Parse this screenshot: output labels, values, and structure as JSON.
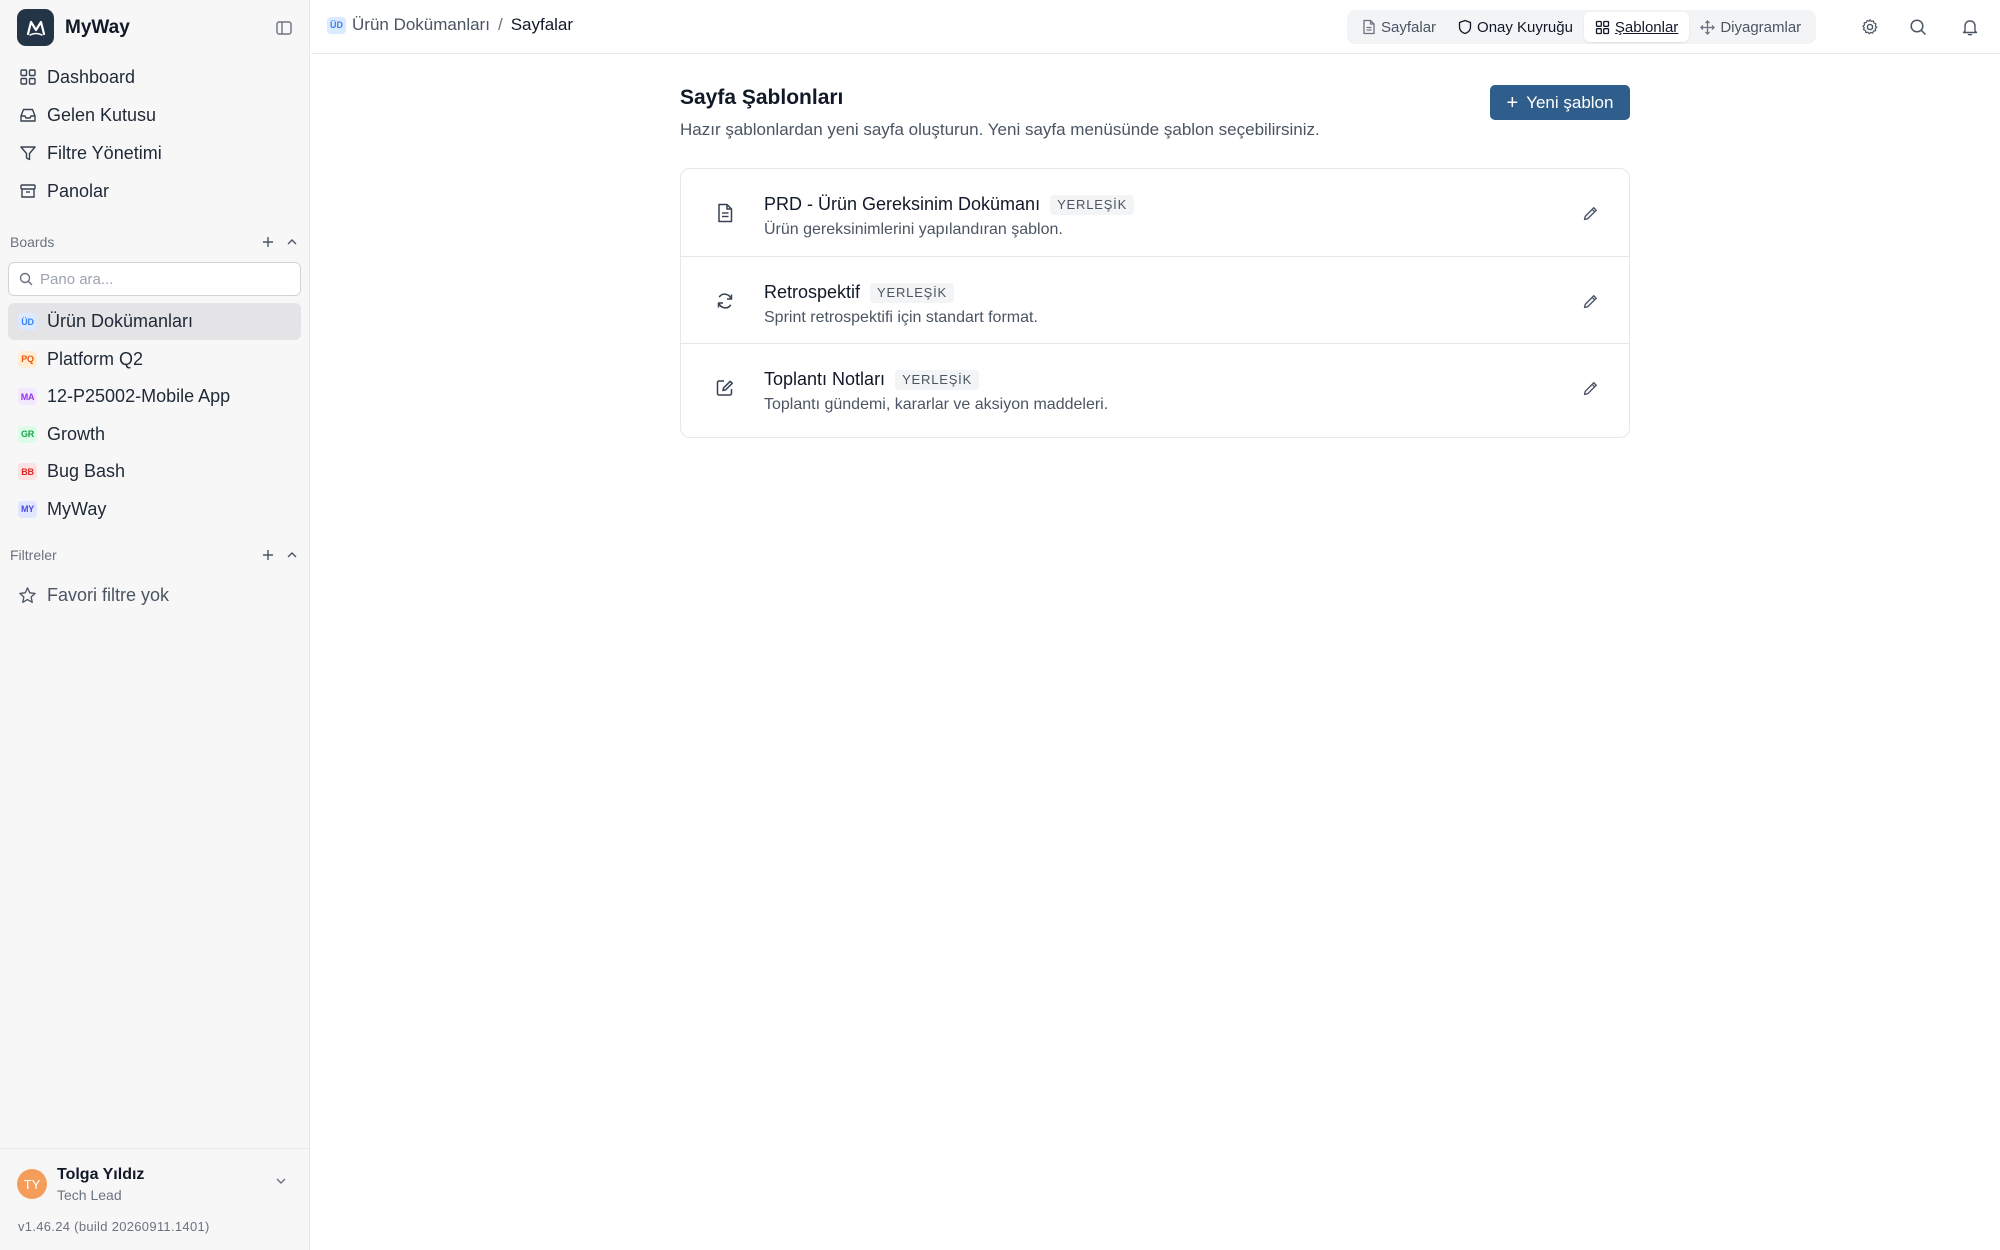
{
  "app": {
    "name": "MyWay"
  },
  "sidebar": {
    "nav": [
      {
        "label": "Dashboard",
        "icon": "dashboard-icon"
      },
      {
        "label": "Gelen Kutusu",
        "icon": "inbox-icon"
      },
      {
        "label": "Filtre Yönetimi",
        "icon": "filter-icon"
      },
      {
        "label": "Panolar",
        "icon": "archive-icon"
      }
    ],
    "boards_heading": "Boards",
    "board_search_placeholder": "Pano ara...",
    "boards": [
      {
        "abbr": "ÜD",
        "label": "Ürün Dokümanları",
        "active": true,
        "badge_bg": "#dbeafe",
        "badge_fg": "#3b82f6"
      },
      {
        "abbr": "PQ",
        "label": "Platform Q2",
        "active": false,
        "badge_bg": "#ffedd5",
        "badge_fg": "#ea580c"
      },
      {
        "abbr": "MA",
        "label": "12-P25002-Mobile App",
        "active": false,
        "badge_bg": "#f3e8ff",
        "badge_fg": "#9333ea"
      },
      {
        "abbr": "GR",
        "label": "Growth",
        "active": false,
        "badge_bg": "#dcfce7",
        "badge_fg": "#16a34a"
      },
      {
        "abbr": "BB",
        "label": "Bug Bash",
        "active": false,
        "badge_bg": "#fee2e2",
        "badge_fg": "#dc2626"
      },
      {
        "abbr": "MY",
        "label": "MyWay",
        "active": false,
        "badge_bg": "#e0e7ff",
        "badge_fg": "#4f46e5"
      }
    ],
    "filters_heading": "Filtreler",
    "favorites_empty": "Favori filtre yok",
    "user": {
      "initials": "TY",
      "name": "Tolga Yıldız",
      "role": "Tech Lead"
    },
    "version": "v1.46.24 (build 20260911.1401)"
  },
  "topbar": {
    "breadcrumb": {
      "board_abbr": "ÜD",
      "board": "Ürün Dokümanları",
      "separator": "/",
      "current": "Sayfalar"
    },
    "tabs": [
      {
        "label": "Sayfalar",
        "icon": "file-icon"
      },
      {
        "label": "Onay Kuyruğu",
        "icon": "shield-icon"
      },
      {
        "label": "Şablonlar",
        "icon": "grid-icon"
      },
      {
        "label": "Diyagramlar",
        "icon": "diagram-icon"
      }
    ]
  },
  "main": {
    "title": "Sayfa Şablonları",
    "subtitle": "Hazır şablonlardan yeni sayfa oluşturun. Yeni sayfa menüsünde şablon seçebilirsiniz.",
    "new_button": {
      "plus": "+",
      "label": "Yeni şablon"
    },
    "templates": [
      {
        "name": "PRD - Ürün Gereksinim Dokümanı",
        "badge": "YERLEŞİK",
        "desc": "Ürün gereksinimlerini yapılandıran şablon.",
        "icon": "document-icon"
      },
      {
        "name": "Retrospektif",
        "badge": "YERLEŞİK",
        "desc": "Sprint retrospektifi için standart format.",
        "icon": "refresh-icon"
      },
      {
        "name": "Toplantı Notları",
        "badge": "YERLEŞİK",
        "desc": "Toplantı gündemi, kararlar ve aksiyon maddeleri.",
        "icon": "edit-square-icon"
      }
    ]
  },
  "colors": {
    "primary": "#2f5d8c",
    "avatar": "#f59e5b",
    "sidebar_bg": "#f7f7f8"
  }
}
